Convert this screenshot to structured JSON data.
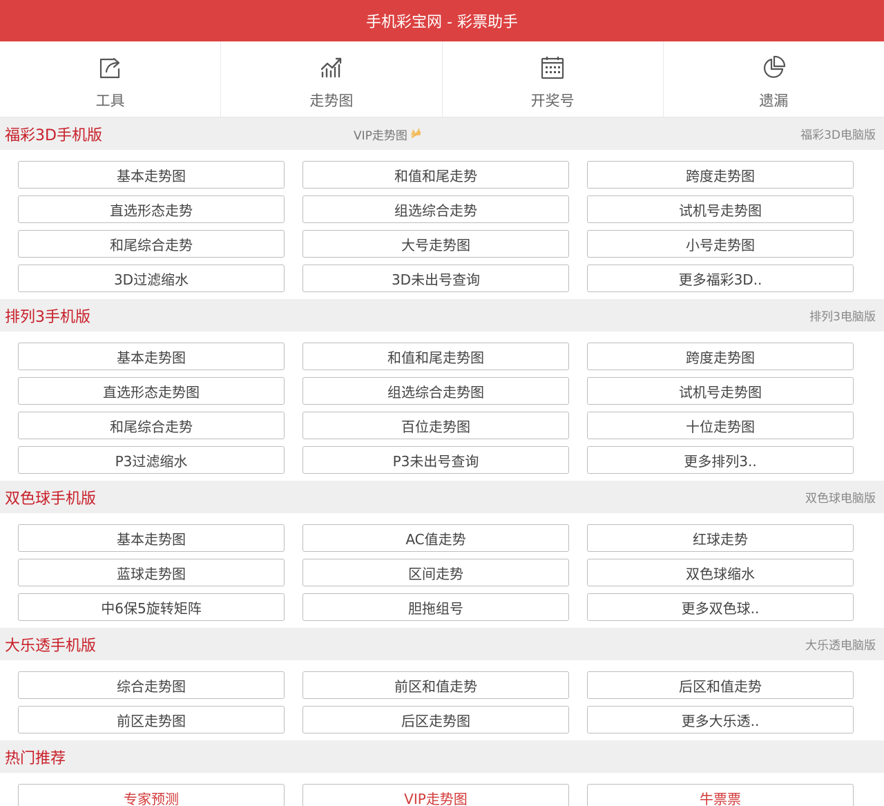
{
  "header": {
    "title": "手机彩宝网 - 彩票助手"
  },
  "colors": {
    "brand": "#dc4141",
    "section_title": "#c8202a"
  },
  "nav": [
    {
      "label": "工具",
      "icon": "share-icon"
    },
    {
      "label": "走势图",
      "icon": "chart-icon"
    },
    {
      "label": "开奖号",
      "icon": "calendar-icon"
    },
    {
      "label": "遗漏",
      "icon": "pie-chart-icon"
    }
  ],
  "sections": [
    {
      "title": "福彩3D手机版",
      "vip_center": "VIP走势图",
      "link": "福彩3D电脑版",
      "buttons": [
        "基本走势图",
        "和值和尾走势",
        "跨度走势图",
        "直选形态走势",
        "组选综合走势",
        "试机号走势图",
        "和尾综合走势",
        "大号走势图",
        "小号走势图",
        "3D过滤缩水",
        "3D未出号查询",
        "更多福彩3D.."
      ]
    },
    {
      "title": "排列3手机版",
      "link": "排列3电脑版",
      "buttons": [
        "基本走势图",
        "和值和尾走势图",
        "跨度走势图",
        "直选形态走势图",
        "组选综合走势图",
        "试机号走势图",
        "和尾综合走势",
        "百位走势图",
        "十位走势图",
        "P3过滤缩水",
        "P3未出号查询",
        "更多排列3.."
      ]
    },
    {
      "title": "双色球手机版",
      "link": "双色球电脑版",
      "buttons": [
        "基本走势图",
        "AC值走势",
        "红球走势",
        "蓝球走势图",
        "区间走势",
        "双色球缩水",
        "中6保5旋转矩阵",
        "胆拖组号",
        "更多双色球.."
      ]
    },
    {
      "title": "大乐透手机版",
      "link": "大乐透电脑版",
      "buttons": [
        "综合走势图",
        "前区和值走势",
        "后区和值走势",
        "前区走势图",
        "后区走势图",
        "更多大乐透.."
      ]
    },
    {
      "title": "热门推荐",
      "buttons": [
        "专家预测",
        "VIP走势图",
        "牛票票"
      ]
    }
  ]
}
